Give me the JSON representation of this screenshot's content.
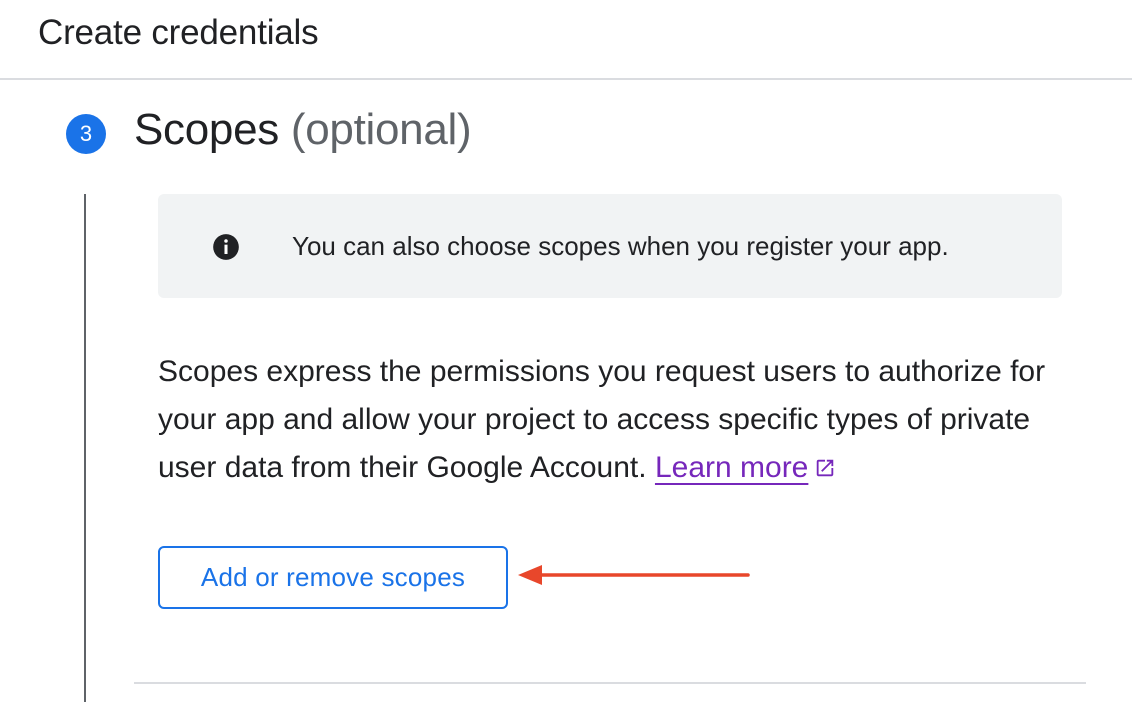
{
  "header": {
    "title": "Create credentials"
  },
  "step": {
    "number": "3",
    "title": "Scopes",
    "title_suffix": "(optional)"
  },
  "info_banner": {
    "icon": "info-icon",
    "text": "You can also choose scopes when you register your app."
  },
  "description": {
    "text": "Scopes express the permissions you request users to authorize for your app and allow your project to access specific types of private user data from their Google Account.",
    "link_label": "Learn more",
    "link_icon": "external-link-icon"
  },
  "actions": {
    "add_scopes_label": "Add or remove scopes"
  },
  "annotation": {
    "arrow_color": "#e8472b"
  },
  "colors": {
    "accent": "#1a73e8",
    "link": "#7627bb",
    "banner_bg": "#f1f3f4"
  }
}
